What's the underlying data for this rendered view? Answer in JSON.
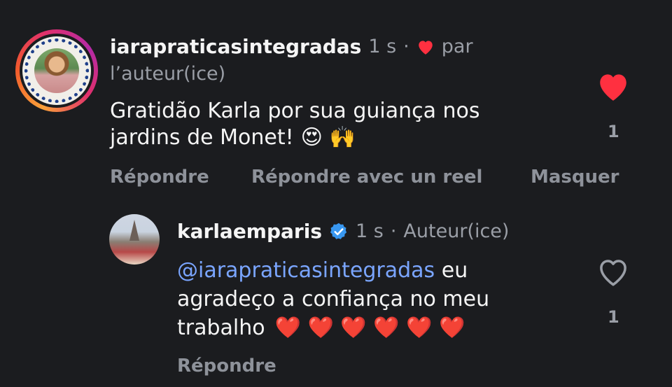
{
  "comment1": {
    "username": "iarapraticasintegradas",
    "time": "1 s",
    "separator": "·",
    "by_label": "par",
    "author_label": "l’auteur(ice)",
    "text_line1": "Gratidão Karla por sua guiança nos",
    "text_line2": "jardins de Monet!",
    "emoji1": "😍",
    "emoji2": "🙌",
    "like_count": "1",
    "actions": {
      "reply": "Répondre",
      "reply_reel": "Répondre avec un reel",
      "hide": "Masquer"
    },
    "liked": true,
    "like_color": "#ff3040"
  },
  "comment2": {
    "username": "karlaemparis",
    "verified": true,
    "time": "1 s",
    "separator": "·",
    "author_label": "Auteur(ice)",
    "mention": "@iarapraticasintegradas",
    "text_after_mention": " eu",
    "text_line2": "agradeço a confiança no meu",
    "text_line3": "trabalho",
    "hearts": "❤️ ❤️ ❤️ ❤️ ❤️ ❤️",
    "like_count": "1",
    "actions": {
      "reply": "Répondre"
    },
    "liked": false
  },
  "colors": {
    "background": "#1b1c1f",
    "mention": "#7aa5ff",
    "verified": "#3897f0",
    "secondary_text": "#9a9ea6"
  }
}
